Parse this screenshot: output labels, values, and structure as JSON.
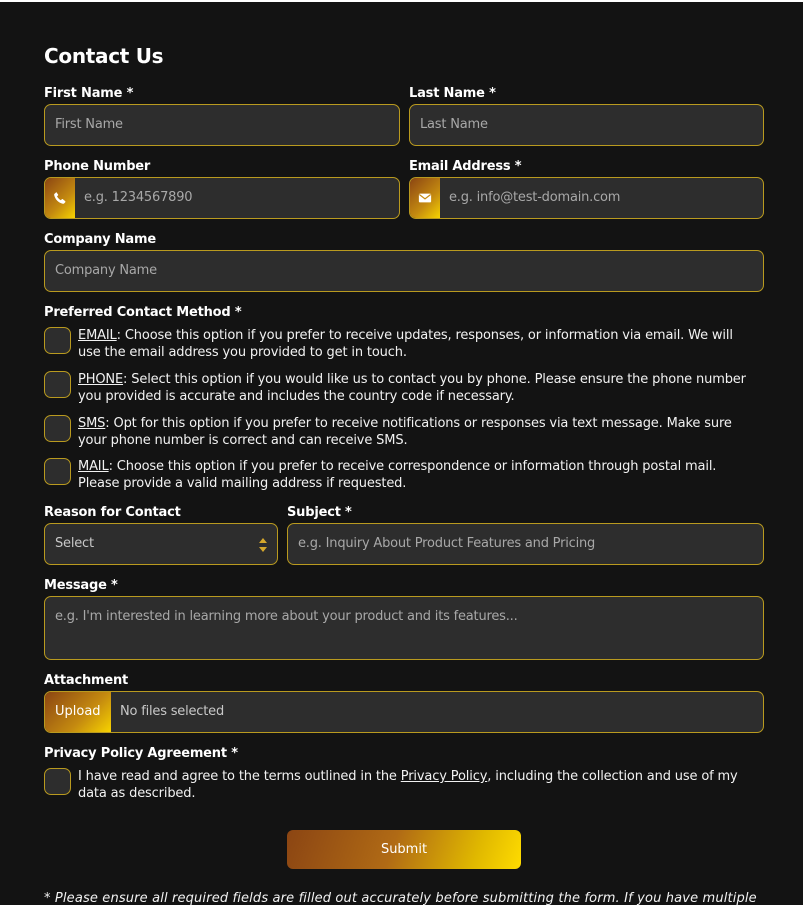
{
  "form": {
    "title": "Contact Us",
    "first_name": {
      "label": "First Name  *",
      "placeholder": "First Name"
    },
    "last_name": {
      "label": "Last Name  *",
      "placeholder": "Last Name"
    },
    "phone": {
      "label": "Phone Number",
      "placeholder": "e.g. 1234567890",
      "icon": "phone-icon"
    },
    "email": {
      "label": "Email Address  *",
      "placeholder": "e.g. info@test-domain.com",
      "icon": "envelope-icon"
    },
    "company": {
      "label": "Company Name",
      "placeholder": "Company Name"
    },
    "contact_method": {
      "label": "Preferred Contact Method  *",
      "options": [
        {
          "name": "EMAIL",
          "text": ": Choose this option if you prefer to receive updates, responses, or information via email. We will use the email address you provided to get in touch."
        },
        {
          "name": "PHONE",
          "text": ": Select this option if you would like us to contact you by phone. Please ensure the phone number you provided is accurate and includes the country code if necessary."
        },
        {
          "name": "SMS",
          "text": ": Opt for this option if you prefer to receive notifications or responses via text message. Make sure your phone number is correct and can receive SMS."
        },
        {
          "name": "MAIL",
          "text": ": Choose this option if you prefer to receive correspondence or information through postal mail. Please provide a valid mailing address if requested."
        }
      ]
    },
    "reason": {
      "label": "Reason for Contact",
      "value": "Select"
    },
    "subject": {
      "label": "Subject  *",
      "placeholder": "e.g. Inquiry About Product Features and Pricing"
    },
    "message": {
      "label": "Message  *",
      "placeholder": "e.g. I'm interested in learning more about your product and its features..."
    },
    "attachment": {
      "label": "Attachment",
      "button": "Upload",
      "status": "No files selected"
    },
    "privacy": {
      "label": "Privacy Policy Agreement  *",
      "text_before": "I have read and agree to the terms outlined in the ",
      "link": "Privacy Policy",
      "text_after": ", including the collection and use of my data as described."
    },
    "submit_label": "Submit",
    "note": "* Please ensure all required fields are filled out accurately before submitting the form. If you have multiple"
  },
  "colors": {
    "accent_border": "#b99a1f",
    "field_bg": "#2d2d2d",
    "page_bg": "#131313",
    "gradient_start": "#8b4513",
    "gradient_end": "#ffdc00"
  }
}
